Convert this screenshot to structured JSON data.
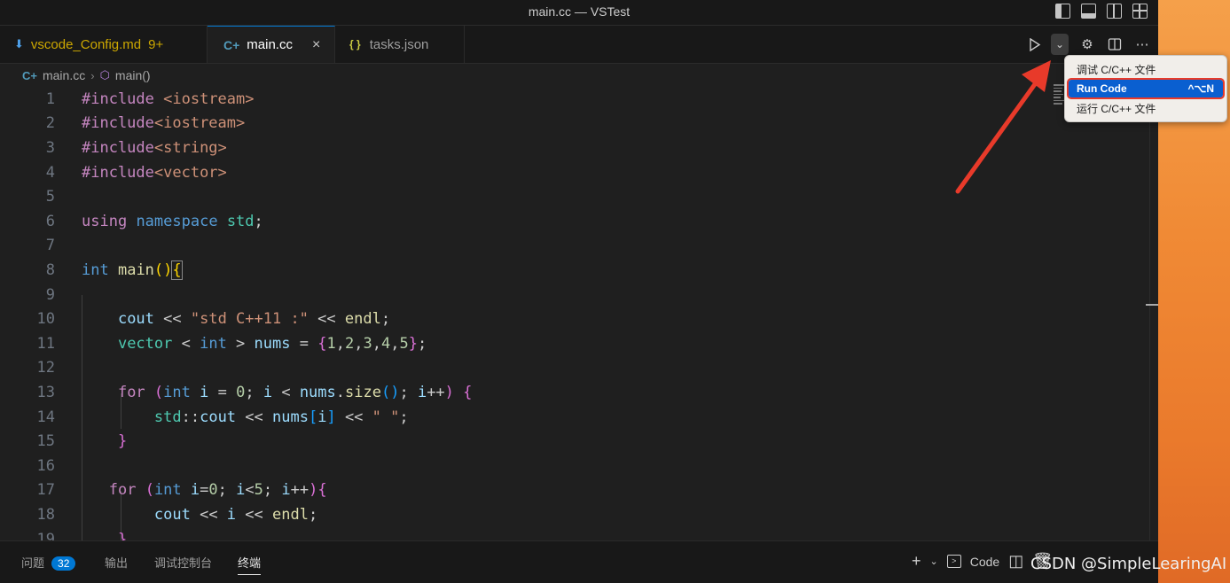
{
  "window": {
    "title": "main.cc — VSTest"
  },
  "tabs": [
    {
      "label": "vscode_Config.md",
      "count": "9+",
      "icon": "markdown-icon"
    },
    {
      "label": "main.cc",
      "icon": "cpp-file-icon",
      "close": "×"
    },
    {
      "label": "tasks.json",
      "icon": "json-icon"
    }
  ],
  "breadcrumb": {
    "file": "main.cc",
    "symbol": "main()"
  },
  "editor": {
    "line_numbers": [
      "1",
      "2",
      "3",
      "4",
      "5",
      "6",
      "7",
      "8",
      "9",
      "10",
      "11",
      "12",
      "13",
      "14",
      "15",
      "16",
      "17",
      "18",
      "19"
    ],
    "lines": [
      "#include <iostream>",
      "#include<iostream>",
      "#include<string>",
      "#include<vector>",
      "",
      "using namespace std;",
      "",
      "int main(){",
      "",
      "    cout << \"std C++11 :\" << endl;",
      "    vector < int > nums = {1,2,3,4,5};",
      "",
      "    for (int i = 0; i < nums.size(); i++) {",
      "        std::cout << nums[i] << \" \";",
      "    }",
      "",
      "   for (int i=0; i<5; i++){",
      "        cout << i << endl;",
      "    }"
    ]
  },
  "menu": {
    "items": [
      {
        "label": "调试 C/C++ 文件",
        "shortcut": ""
      },
      {
        "label": "Run Code",
        "shortcut": "^⌥N"
      },
      {
        "label": "运行 C/C++ 文件",
        "shortcut": ""
      }
    ]
  },
  "panel": {
    "tabs": [
      "问题",
      "输出",
      "调试控制台",
      "终端"
    ],
    "problems_count": "32",
    "active_tab": "终端",
    "terminal_profile": "Code"
  },
  "watermark": "CSDN @SimpleLearingAI",
  "colors": {
    "accent": "#0078d4",
    "arrow": "#e83a2a",
    "menu_highlight": "#0a5fd0"
  }
}
